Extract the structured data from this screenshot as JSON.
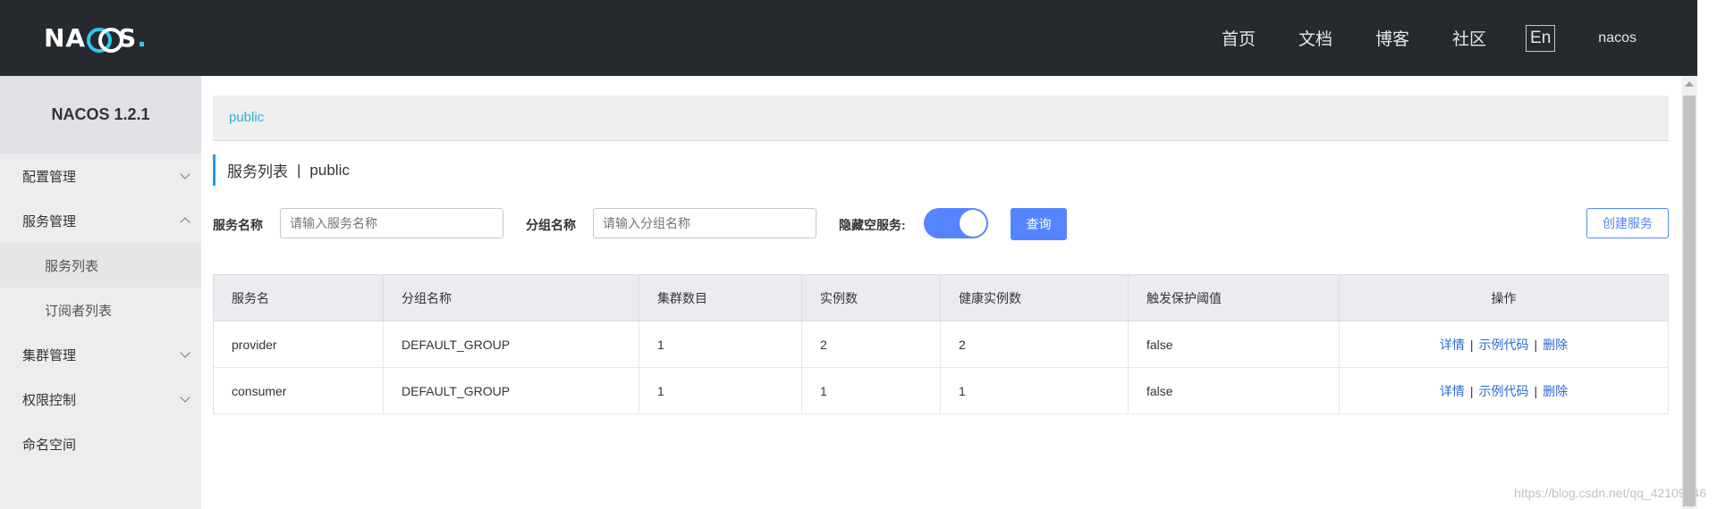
{
  "header": {
    "logo_text_a": "NA",
    "logo_text_b": "S",
    "logo_dot": ".",
    "nav": [
      "首页",
      "文档",
      "博客",
      "社区"
    ],
    "lang": "En",
    "user": "nacos"
  },
  "sidebar": {
    "title": "NACOS 1.2.1",
    "items": [
      {
        "label": "配置管理"
      },
      {
        "label": "服务管理"
      },
      {
        "label": "服务列表"
      },
      {
        "label": "订阅者列表"
      },
      {
        "label": "集群管理"
      },
      {
        "label": "权限控制"
      },
      {
        "label": "命名空间"
      }
    ]
  },
  "main": {
    "breadcrumb": "public",
    "title": "服务列表",
    "title_sep": "|",
    "title_ns": "public",
    "filter": {
      "service_label": "服务名称",
      "service_placeholder": "请输入服务名称",
      "group_label": "分组名称",
      "group_placeholder": "请输入分组名称",
      "hide_empty_label": "隐藏空服务:",
      "hide_empty_on": true,
      "query_button": "查询",
      "create_button": "创建服务"
    },
    "table": {
      "columns": [
        "服务名",
        "分组名称",
        "集群数目",
        "实例数",
        "健康实例数",
        "触发保护阈值",
        "操作"
      ],
      "rows": [
        {
          "name": "provider",
          "group": "DEFAULT_GROUP",
          "clusters": "1",
          "instances": "2",
          "healthy": "2",
          "threshold": "false"
        },
        {
          "name": "consumer",
          "group": "DEFAULT_GROUP",
          "clusters": "1",
          "instances": "1",
          "healthy": "1",
          "threshold": "false"
        }
      ],
      "actions": {
        "detail": "详情",
        "sample": "示例代码",
        "delete": "删除",
        "sep": "|"
      }
    }
  },
  "watermark": "https://blog.csdn.net/qq_42109746",
  "colors": {
    "header_bg": "#252a2f",
    "accent": "#5584ff",
    "link": "#2a6ad9",
    "breadcrumb": "#2fb0cf"
  }
}
